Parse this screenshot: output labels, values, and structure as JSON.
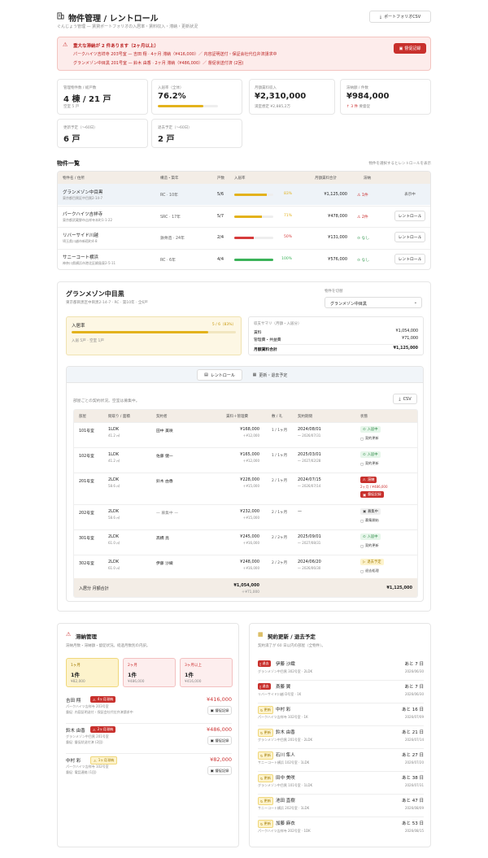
{
  "header": {
    "title": "物件管理 / レントロール",
    "subtitle": "ぐんじょう管理 — 賃貸ポートフォリオの入居率・賃料収入・滞納・更新状況",
    "csv_button": "ポートフォリオCSV"
  },
  "alert": {
    "title": "重大な滞納が 2 件あります（2ヶ月以上）",
    "line1": "パークハイツ吉祥寺 203号室 — 吉田 翔 · 4ヶ月 滞納（¥416,000）／ 内容証明送付・保証会社代位弁済請求中",
    "line2": "グランメゾン中目黒 201号室 — 鈴木 由香 · 2ヶ月 滞納（¥486,000）／ 督促状送付済 (2回)",
    "button": "督促記録"
  },
  "kpis": [
    {
      "label": "管理物件数 / 総戸数",
      "value": "4 棟 / 21 戸",
      "sub": "空室 5 戸"
    },
    {
      "label": "入居率（全体）",
      "value": "76.2%",
      "progress": 0.762
    },
    {
      "label": "月額賃料収入",
      "value": "¥2,310,000",
      "sub": "満室想定 ¥2,885,2万"
    },
    {
      "label": "滞納額 / 件数",
      "value": "¥984,000",
      "sub": "3 件",
      "sub_suffix": "要督促"
    },
    {
      "label": "更新予定（〜60日）",
      "value": "6 戸"
    },
    {
      "label": "退去予定（〜60日）",
      "value": "2 戸"
    }
  ],
  "properties": {
    "section_title": "物件一覧",
    "hint": "物件を選択するとレントロールを表示",
    "headers": [
      "物件名 / 住所",
      "構造・築年",
      "戸数",
      "入居率",
      "月額賃料合計",
      "滞納",
      ""
    ],
    "rows": [
      {
        "name": "グランメゾン中目黒",
        "addr": "東京都目黒区中目黒2-14-7",
        "struct": "RC · 10年",
        "units": "5/6",
        "occ": 0.83,
        "occ_label": "83%",
        "occ_color": "#e3b21c",
        "rent": "¥1,125,000",
        "delinq": "1件",
        "delinq_type": "alert",
        "action": "表示中"
      },
      {
        "name": "パークハイツ吉祥寺",
        "addr": "東京都武蔵野市吉祥寺本町1-1-22",
        "struct": "SRC · 17年",
        "units": "5/7",
        "occ": 0.71,
        "occ_label": "71%",
        "occ_color": "#e3b21c",
        "rent": "¥478,000",
        "delinq": "2件",
        "delinq_type": "alert",
        "action": "レントロール"
      },
      {
        "name": "リバーサイド川越",
        "addr": "埼玉県川越市新宿町4-8",
        "struct": "鉄骨造 · 24年",
        "units": "2/4",
        "occ": 0.5,
        "occ_label": "50%",
        "occ_color": "#d63b3b",
        "rent": "¥131,000",
        "delinq": "なし",
        "delinq_type": "ok",
        "action": "レントロール"
      },
      {
        "name": "サニーコート横浜",
        "addr": "神奈川県横浜市港北区綱島東2-5-11",
        "struct": "RC · 6年",
        "units": "4/4",
        "occ": 1.0,
        "occ_label": "100%",
        "occ_color": "#3cb35a",
        "rent": "¥576,000",
        "delinq": "なし",
        "delinq_type": "ok",
        "action": "レントロール"
      }
    ]
  },
  "detail": {
    "title": "グランメゾン中目黒",
    "addr": "東京都目黒区中目黒2-14-7 · RC · 築10年 · 全6戸",
    "switch_label": "物件を切替",
    "switch_value": "グランメゾン中目黒",
    "occ_label": "入居率",
    "occ_value": "5 / 6（83%）",
    "occ_progress": 0.83,
    "occ_sub": "入居 5戸 · 空室 1戸",
    "summary_label": "収支サマリ（月額・入居分）",
    "summary": [
      {
        "k": "賃料",
        "v": "¥1,054,000"
      },
      {
        "k": "管理費・共益費",
        "v": "¥71,000"
      },
      {
        "k": "月額賃料合計",
        "v": "¥1,125,000"
      }
    ],
    "tabs": [
      "レントロール",
      "更新・退去予定"
    ],
    "table_note": "部屋ごとの契約状況。空室は募集中。",
    "csv": "CSV",
    "headers": [
      "部屋",
      "間取り / 面積",
      "契約者",
      "賃料＋管理費",
      "敷 / 礼",
      "契約期間",
      "状態"
    ],
    "rows": [
      {
        "room": "101号室",
        "layout": "1LDK",
        "area": "41.2 ㎡",
        "tenant": "田中 美咲",
        "rent": "¥168,000",
        "fee": "＋¥12,000",
        "deposit": "1 / 1ヶ月",
        "start": "2024/08/01",
        "end": "〜 2026/07/31",
        "status": "入居中",
        "stype": "green",
        "act": "契約更新"
      },
      {
        "room": "102号室",
        "layout": "1LDK",
        "area": "41.2 ㎡",
        "tenant": "佐藤 健一",
        "rent": "¥165,000",
        "fee": "＋¥12,000",
        "deposit": "1 / 1ヶ月",
        "start": "2025/03/01",
        "end": "〜 2027/02/28",
        "status": "入居中",
        "stype": "green",
        "act": "契約更新"
      },
      {
        "room": "201号室",
        "layout": "2LDK",
        "area": "58.6 ㎡",
        "tenant": "鈴木 由香",
        "rent": "¥228,000",
        "fee": "＋¥15,000",
        "deposit": "2 / 1ヶ月",
        "start": "2024/07/15",
        "end": "〜 2026/07/14",
        "status": "滞納",
        "stype": "red",
        "extra": "2ヶ月 / ¥486,000",
        "act": "督促記録"
      },
      {
        "room": "202号室",
        "layout": "2LDK",
        "area": "58.6 ㎡",
        "tenant": "— 募集中 —",
        "rent": "¥232,000",
        "fee": "＋¥15,000",
        "deposit": "2 / 1ヶ月",
        "start": "—",
        "end": "",
        "status": "募集中",
        "stype": "gray",
        "act": "募集開始"
      },
      {
        "room": "301号室",
        "layout": "2LDK",
        "area": "61.0 ㎡",
        "tenant": "高橋 亮",
        "rent": "¥245,000",
        "fee": "＋¥16,000",
        "deposit": "2 / 2ヶ月",
        "start": "2025/09/01",
        "end": "〜 2027/08/31",
        "status": "入居中",
        "stype": "green",
        "act": "契約更新"
      },
      {
        "room": "302号室",
        "layout": "2LDK",
        "area": "61.0 ㎡",
        "tenant": "伊藤 沙織",
        "rent": "¥248,000",
        "fee": "＋¥16,000",
        "deposit": "2 / 2ヶ月",
        "start": "2024/06/20",
        "end": "〜 2026/06/30",
        "status": "退去予定",
        "stype": "yellow",
        "act": "退去処理"
      }
    ],
    "footer_label": "入居分 月額合計",
    "footer_rent": "¥1,054,000",
    "footer_fee": "＋¥71,000",
    "footer_total": "¥1,125,000"
  },
  "delinquency": {
    "title": "滞納管理",
    "sub": "滞納月数・滞納額・督促状況。経過月数別の内訳。",
    "buckets": [
      {
        "label": "1ヶ月",
        "count": "1件",
        "amount": "¥82,000"
      },
      {
        "label": "2ヶ月",
        "count": "1件",
        "amount": "¥486,000"
      },
      {
        "label": "3ヶ月以上",
        "count": "1件",
        "amount": "¥416,000"
      }
    ],
    "items": [
      {
        "name": "吉田 翔",
        "badge": "4ヶ月滞納",
        "level": "red",
        "prop": "パークハイツ吉祥寺 203号室",
        "note": "督促: 内容証明送付・保証会社代位弁済請求中",
        "amount": "¥416,000",
        "btn": "督促記録"
      },
      {
        "name": "鈴木 由香",
        "badge": "2ヶ月滞納",
        "level": "red",
        "prop": "グランメゾン中目黒 201号室",
        "note": "督促: 督促状送付済 (2回)",
        "amount": "¥486,000",
        "btn": "督促記録"
      },
      {
        "name": "中村 彩",
        "badge": "1ヶ月滞納",
        "level": "yellow",
        "prop": "パークハイツ吉祥寺 102号室",
        "note": "督促: 電話連絡 (1回)",
        "amount": "¥82,000",
        "btn": "督促記録"
      }
    ]
  },
  "renewals": {
    "title": "契約更新 / 退去予定",
    "sub": "契約満了が 60 日以内の部屋（全物件）。",
    "items": [
      {
        "tag": "退去",
        "tagtype": "red",
        "name": "伊藤 沙織",
        "prop": "グランメゾン中目黒 302号室 · 2LDK",
        "days": "あと 7 日",
        "date": "2026/06/30"
      },
      {
        "tag": "退去",
        "tagtype": "red",
        "name": "斎藤 翼",
        "prop": "リバーサイド川越 D号室 · 1K",
        "days": "あと 7 日",
        "date": "2026/06/30"
      },
      {
        "tag": "更新",
        "tagtype": "yellow",
        "name": "中村 彩",
        "prop": "パークハイツ吉祥寺 102号室 · 1K",
        "days": "あと 16 日",
        "date": "2026/07/09"
      },
      {
        "tag": "更新",
        "tagtype": "yellow",
        "name": "鈴木 由香",
        "prop": "グランメゾン中目黒 201号室 · 2LDK",
        "days": "あと 21 日",
        "date": "2026/07/14"
      },
      {
        "tag": "更新",
        "tagtype": "yellow",
        "name": "石川 隼人",
        "prop": "サニーコート横浜 102号室 · 1LDK",
        "days": "あと 27 日",
        "date": "2026/07/20"
      },
      {
        "tag": "更新",
        "tagtype": "yellow",
        "name": "田中 美咲",
        "prop": "グランメゾン中目黒 101号室 · 1LDK",
        "days": "あと 38 日",
        "date": "2026/07/31"
      },
      {
        "tag": "更新",
        "tagtype": "yellow",
        "name": "池田 直樹",
        "prop": "サニーコート横浜 202号室 · 1LDK",
        "days": "あと 47 日",
        "date": "2026/08/09"
      },
      {
        "tag": "更新",
        "tagtype": "yellow",
        "name": "加藤 麻衣",
        "prop": "パークハイツ吉祥寺 202号室 · 1DK",
        "days": "あと 53 日",
        "date": "2026/08/15"
      }
    ]
  }
}
